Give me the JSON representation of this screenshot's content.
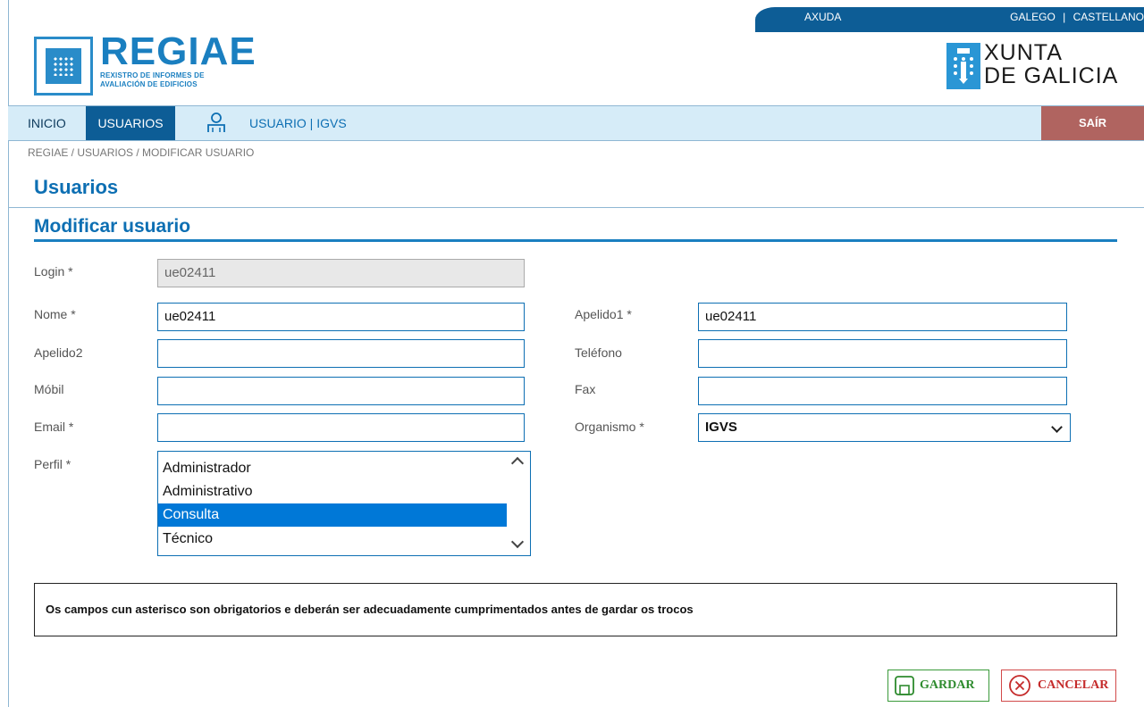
{
  "topbar": {
    "help": "AXUDA",
    "lang1": "GALEGO",
    "sep": "|",
    "lang2": "CASTELLANO"
  },
  "brand": {
    "name": "REGIAE",
    "sub_line1": "REXISTRO DE INFORMES DE",
    "sub_line2": "AVALIACIÓN DE EDIFICIOS"
  },
  "gov": {
    "line1": "XUNTA",
    "line2": "DE GALICIA"
  },
  "nav": {
    "home": "INICIO",
    "users": "USUARIOS",
    "user_info": "USUARIO | IGVS",
    "logout": "SAÍR"
  },
  "breadcrumb": "REGIAE / USUARIOS / MODIFICAR USUARIO",
  "page_title": "Usuarios",
  "section_title": "Modificar usuario",
  "form": {
    "login": {
      "label": "Login *",
      "value": "ue02411"
    },
    "nome": {
      "label": "Nome *",
      "value": "ue02411"
    },
    "apelido1": {
      "label": "Apelido1 *",
      "value": "ue02411"
    },
    "apelido2": {
      "label": "Apelido2",
      "value": ""
    },
    "telefono": {
      "label": "Teléfono",
      "value": ""
    },
    "mobil": {
      "label": "Móbil",
      "value": ""
    },
    "fax": {
      "label": "Fax",
      "value": ""
    },
    "email": {
      "label": "Email *",
      "value": ""
    },
    "organismo": {
      "label": "Organismo *",
      "value": "IGVS"
    },
    "perfil": {
      "label": "Perfil *",
      "options": [
        "Administrador",
        "Administrativo",
        "Consulta",
        "Técnico"
      ],
      "selected": "Consulta"
    }
  },
  "notice": "Os campos cun asterisco son obrigatorios e deberán ser adecuadamente cumprimentados antes de gardar os trocos",
  "actions": {
    "save": "GARDAR",
    "cancel": "CANCELAR"
  },
  "colors": {
    "primary": "#0d5d96",
    "accent": "#1a7fc0",
    "logout": "#b06460",
    "save": "#2e8b2e",
    "cancel": "#c52b2b",
    "selected": "#0078d7"
  },
  "icons": {
    "user": "user-icon",
    "save": "save-icon",
    "cancel": "cancel-icon"
  }
}
